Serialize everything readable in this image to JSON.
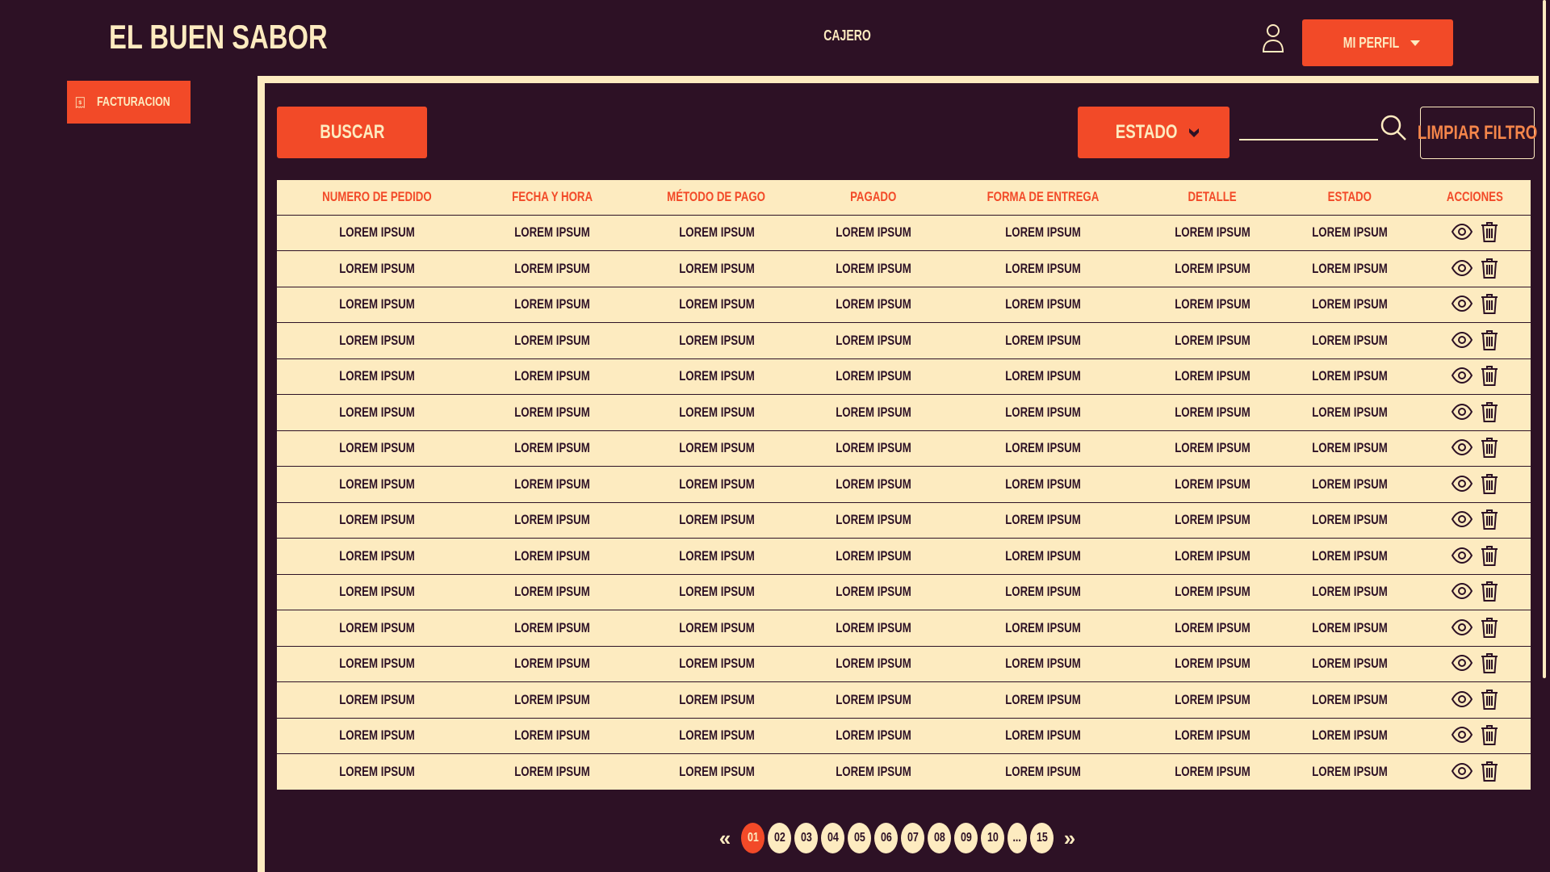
{
  "header": {
    "logo_text": "EL BUEN SABOR",
    "nav_item": "CAJERO",
    "profile_label": "MI PERFIL"
  },
  "sidebar": {
    "items": [
      {
        "label": "FACTURACION",
        "icon": "receipt-dollar-icon"
      }
    ]
  },
  "toolbar": {
    "buscar_label": "BUSCAR",
    "estado_label": "ESTADO",
    "search_value": "",
    "clear_label": "LIMPIAR FILTRO"
  },
  "table": {
    "columns": [
      "NUMERO DE PEDIDO",
      "FECHA Y HORA",
      "MÉTODO DE PAGO",
      "PAGADO",
      "FORMA DE ENTREGA",
      "DETALLE",
      "ESTADO",
      "ACCIONES"
    ],
    "rows": [
      [
        "LOREM IPSUM",
        "LOREM IPSUM",
        "LOREM IPSUM",
        "LOREM IPSUM",
        "LOREM IPSUM",
        "LOREM IPSUM",
        "LOREM IPSUM"
      ],
      [
        "LOREM IPSUM",
        "LOREM IPSUM",
        "LOREM IPSUM",
        "LOREM IPSUM",
        "LOREM IPSUM",
        "LOREM IPSUM",
        "LOREM IPSUM"
      ],
      [
        "LOREM IPSUM",
        "LOREM IPSUM",
        "LOREM IPSUM",
        "LOREM IPSUM",
        "LOREM IPSUM",
        "LOREM IPSUM",
        "LOREM IPSUM"
      ],
      [
        "LOREM IPSUM",
        "LOREM IPSUM",
        "LOREM IPSUM",
        "LOREM IPSUM",
        "LOREM IPSUM",
        "LOREM IPSUM",
        "LOREM IPSUM"
      ],
      [
        "LOREM IPSUM",
        "LOREM IPSUM",
        "LOREM IPSUM",
        "LOREM IPSUM",
        "LOREM IPSUM",
        "LOREM IPSUM",
        "LOREM IPSUM"
      ],
      [
        "LOREM IPSUM",
        "LOREM IPSUM",
        "LOREM IPSUM",
        "LOREM IPSUM",
        "LOREM IPSUM",
        "LOREM IPSUM",
        "LOREM IPSUM"
      ],
      [
        "LOREM IPSUM",
        "LOREM IPSUM",
        "LOREM IPSUM",
        "LOREM IPSUM",
        "LOREM IPSUM",
        "LOREM IPSUM",
        "LOREM IPSUM"
      ],
      [
        "LOREM IPSUM",
        "LOREM IPSUM",
        "LOREM IPSUM",
        "LOREM IPSUM",
        "LOREM IPSUM",
        "LOREM IPSUM",
        "LOREM IPSUM"
      ],
      [
        "LOREM IPSUM",
        "LOREM IPSUM",
        "LOREM IPSUM",
        "LOREM IPSUM",
        "LOREM IPSUM",
        "LOREM IPSUM",
        "LOREM IPSUM"
      ],
      [
        "LOREM IPSUM",
        "LOREM IPSUM",
        "LOREM IPSUM",
        "LOREM IPSUM",
        "LOREM IPSUM",
        "LOREM IPSUM",
        "LOREM IPSUM"
      ],
      [
        "LOREM IPSUM",
        "LOREM IPSUM",
        "LOREM IPSUM",
        "LOREM IPSUM",
        "LOREM IPSUM",
        "LOREM IPSUM",
        "LOREM IPSUM"
      ],
      [
        "LOREM IPSUM",
        "LOREM IPSUM",
        "LOREM IPSUM",
        "LOREM IPSUM",
        "LOREM IPSUM",
        "LOREM IPSUM",
        "LOREM IPSUM"
      ],
      [
        "LOREM IPSUM",
        "LOREM IPSUM",
        "LOREM IPSUM",
        "LOREM IPSUM",
        "LOREM IPSUM",
        "LOREM IPSUM",
        "LOREM IPSUM"
      ],
      [
        "LOREM IPSUM",
        "LOREM IPSUM",
        "LOREM IPSUM",
        "LOREM IPSUM",
        "LOREM IPSUM",
        "LOREM IPSUM",
        "LOREM IPSUM"
      ],
      [
        "LOREM IPSUM",
        "LOREM IPSUM",
        "LOREM IPSUM",
        "LOREM IPSUM",
        "LOREM IPSUM",
        "LOREM IPSUM",
        "LOREM IPSUM"
      ],
      [
        "LOREM IPSUM",
        "LOREM IPSUM",
        "LOREM IPSUM",
        "LOREM IPSUM",
        "LOREM IPSUM",
        "LOREM IPSUM",
        "LOREM IPSUM"
      ]
    ],
    "action_icons": [
      "eye-icon",
      "trash-icon"
    ]
  },
  "pagination": {
    "prev": "«",
    "next": "»",
    "pages": [
      "01",
      "02",
      "03",
      "04",
      "05",
      "06",
      "07",
      "08",
      "09",
      "10",
      "...",
      "15"
    ],
    "active": "01"
  },
  "colors": {
    "background": "#2d1125",
    "accent": "#f24a28",
    "cream": "#fdebc0",
    "outline_text": "#f4854a"
  }
}
